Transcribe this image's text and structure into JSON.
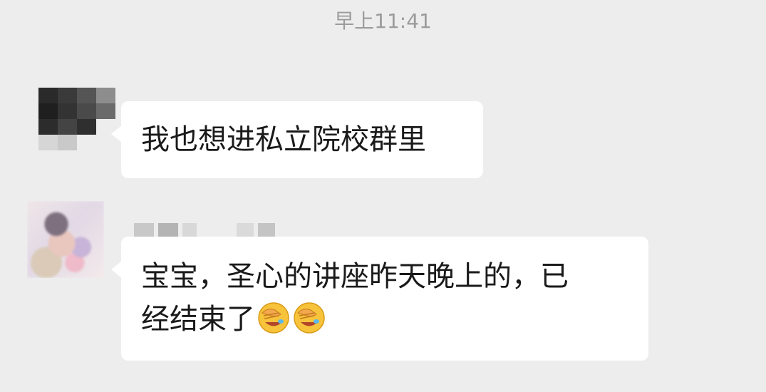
{
  "chat": {
    "timestamp": "早上11:41",
    "messages": [
      {
        "sender_name": "",
        "avatar": "blurred-avatar",
        "text": "我也想进私立院校群里",
        "emojis": []
      },
      {
        "sender_name": "",
        "avatar": "illustrated-avatar",
        "text": "宝宝，圣心的讲座昨天晚上的，已\n经结束了",
        "emojis": [
          "face-palm-emoji",
          "face-palm-emoji"
        ]
      }
    ]
  },
  "colors": {
    "background": "#ededed",
    "bubble": "#ffffff",
    "timestamp_text": "#9b9b9b",
    "message_text": "#1a1a1a"
  }
}
